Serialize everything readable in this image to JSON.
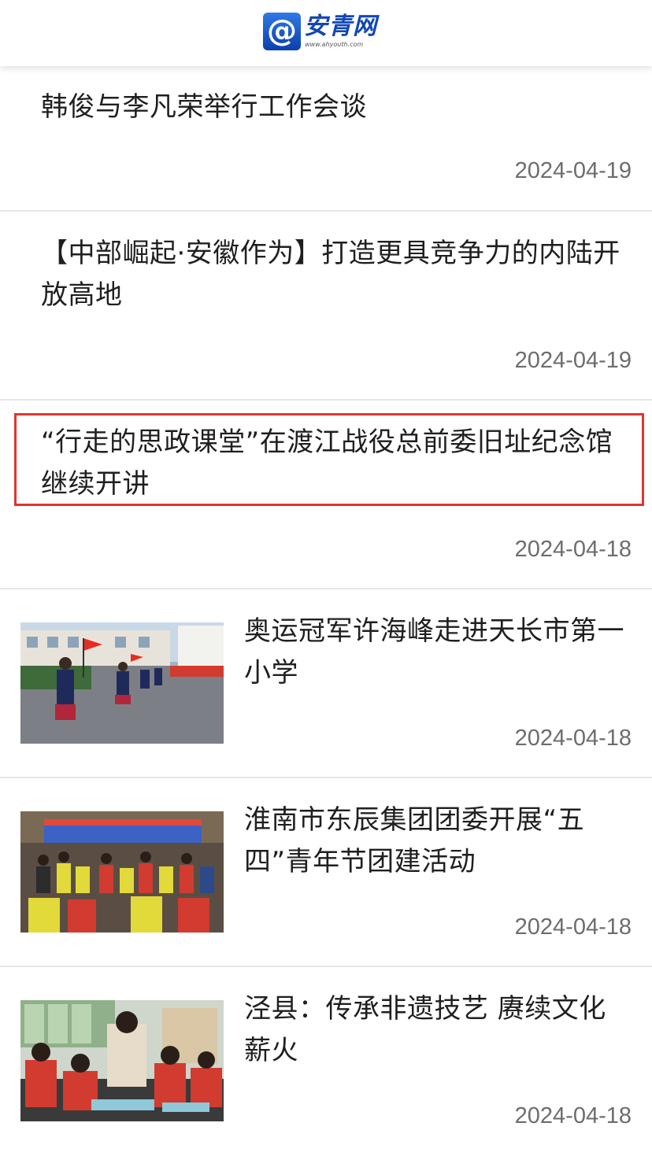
{
  "header": {
    "logo_mark": "@",
    "logo_name": "安青网",
    "logo_url": "www.ahyouth.com"
  },
  "news": [
    {
      "title": "韩俊与李凡荣举行工作会谈",
      "date": "2024-04-19",
      "has_image": false,
      "highlighted": false
    },
    {
      "title": "【中部崛起·安徽作为】打造更具竞争力的内陆开放高地",
      "date": "2024-04-19",
      "has_image": false,
      "highlighted": false
    },
    {
      "title": "“行走的思政课堂”在渡江战役总前委旧址纪念馆继续开讲",
      "date": "2024-04-18",
      "has_image": false,
      "highlighted": true
    },
    {
      "title": "奥运冠军许海峰走进天长市第一小学",
      "date": "2024-04-18",
      "has_image": true,
      "image_desc": "schoolchildren-with-flags-photo",
      "highlighted": false
    },
    {
      "title": "淮南市东辰集团团委开展“五四”青年节团建活动",
      "date": "2024-04-18",
      "has_image": true,
      "image_desc": "youth-group-event-photo",
      "highlighted": false
    },
    {
      "title": "泾县：传承非遗技艺 赓续文化薪火",
      "date": "2024-04-18",
      "has_image": true,
      "image_desc": "classroom-craft-activity-photo",
      "highlighted": false
    }
  ],
  "colors": {
    "brand_blue": "#1246b5",
    "highlight_red": "#e3342f",
    "date_gray": "#6d6d6d"
  }
}
